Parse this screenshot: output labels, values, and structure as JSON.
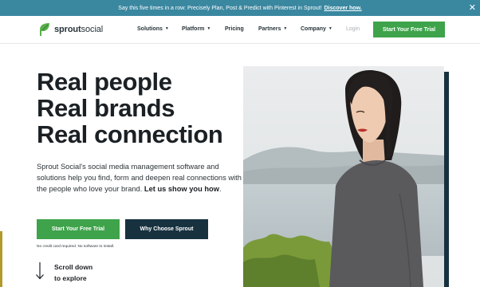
{
  "banner": {
    "text": "Say this five times in a row: Precisely Plan, Post & Predict with Pinterest in Sprout!",
    "link": "Discover how.",
    "close_glyph": "✕"
  },
  "nav": {
    "logo_bold": "sprout",
    "logo_rest": "social",
    "items": [
      {
        "label": "Solutions",
        "dropdown": true
      },
      {
        "label": "Platform",
        "dropdown": true
      },
      {
        "label": "Pricing",
        "dropdown": false
      },
      {
        "label": "Partners",
        "dropdown": true
      },
      {
        "label": "Company",
        "dropdown": true
      }
    ],
    "caret": "▼",
    "login": "Login",
    "cta": "Start Your Free Trial"
  },
  "hero": {
    "headline": [
      "Real people",
      "Real brands",
      "Real connection"
    ],
    "description": "Sprout Social's social media management software and solutions help you find, form and deepen real connections with the people who love your brand.",
    "description_bold": "Let us show you how",
    "description_end": ".",
    "primary_button": "Start Your Free Trial",
    "secondary_button": "Why Choose Sprout",
    "note": "No credit card required. No software to install.",
    "scroll_line1": "Scroll down",
    "scroll_line2": "to explore"
  },
  "colors": {
    "banner": "#3a87a0",
    "brand_green": "#3ea34a",
    "navy": "#17313f",
    "text": "#1b2024"
  },
  "icons": [
    "sprout-leaf-icon",
    "close-icon",
    "chevron-down-icon",
    "arrow-down-icon"
  ]
}
